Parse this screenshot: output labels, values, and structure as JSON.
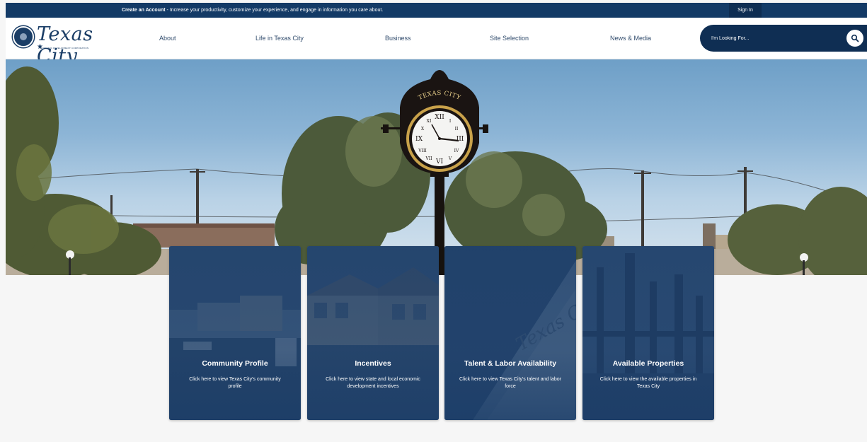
{
  "topbar": {
    "create_account": "Create an Account",
    "message": " - Increase your productivity, customize your experience, and engage in information you care about.",
    "sign_in": "Sign In"
  },
  "logo": {
    "name": "Texas City",
    "tagline": "ECONOMIC DEVELOPMENT CORPORATION"
  },
  "nav": {
    "items": [
      {
        "label": "About"
      },
      {
        "label": "Life in Texas City"
      },
      {
        "label": "Business"
      },
      {
        "label": "Site Selection"
      },
      {
        "label": "News & Media"
      }
    ]
  },
  "search": {
    "placeholder": "I'm Looking For..."
  },
  "hero": {
    "clock_sign": "TEXAS CITY"
  },
  "cards": [
    {
      "title": "Community Profile",
      "description": "Click here to view Texas City's community profile"
    },
    {
      "title": "Incentives",
      "description": "Click here to view state and local economic development incentives"
    },
    {
      "title": "Talent & Labor Availability",
      "description": "Click here to view Texas City's talent and labor force"
    },
    {
      "title": "Available Properties",
      "description": "Click here to view the available properties in Texas City"
    }
  ],
  "colors": {
    "navy": "#133a66",
    "card": "#1b3d68",
    "page_bg": "#f6f6f6"
  }
}
